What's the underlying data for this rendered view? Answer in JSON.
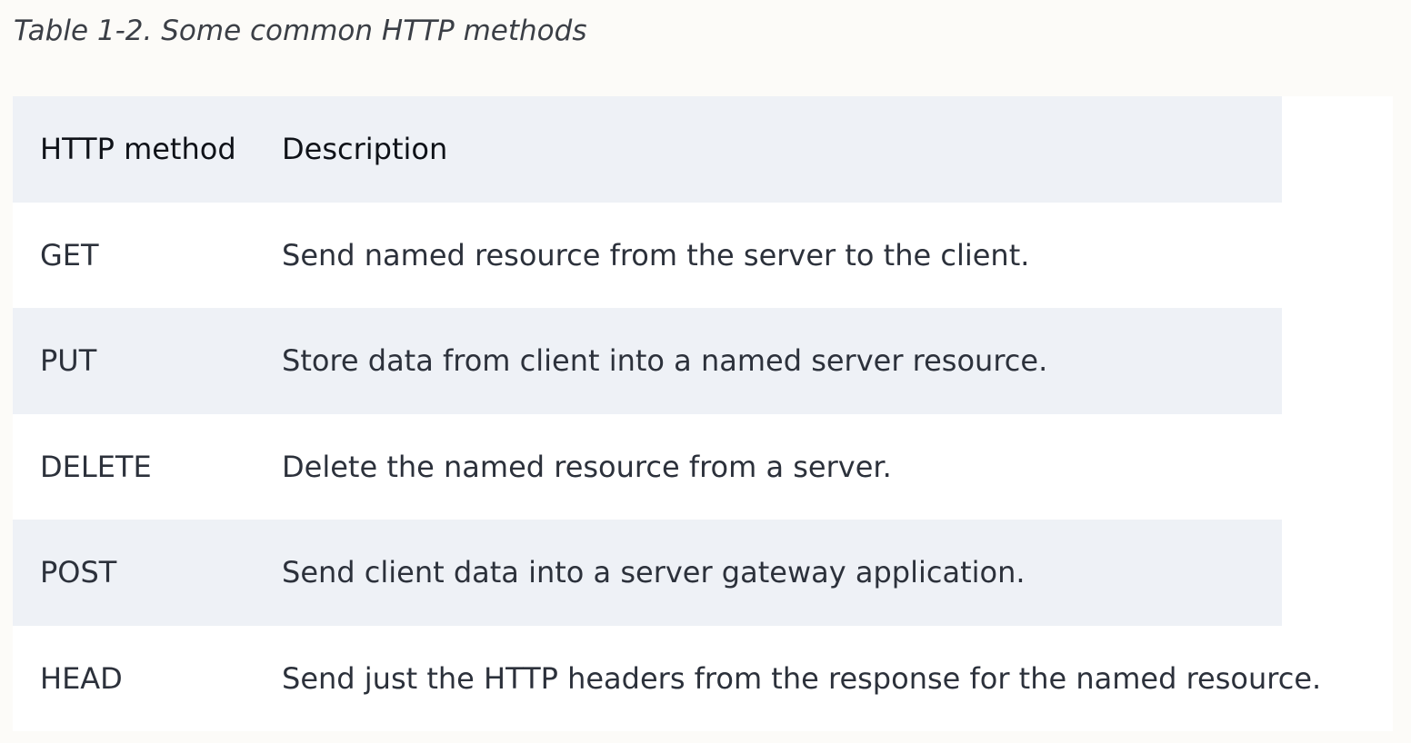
{
  "caption": "Table 1-2. Some common HTTP methods",
  "table": {
    "headers": [
      "HTTP method",
      "Description"
    ],
    "rows": [
      {
        "method": "GET",
        "description": "Send named resource from the server to the client."
      },
      {
        "method": "PUT",
        "description": "Store data from client into a named server resource."
      },
      {
        "method": "DELETE",
        "description": "Delete the named resource from a server."
      },
      {
        "method": "POST",
        "description": "Send client data into a server gateway application."
      },
      {
        "method": "HEAD",
        "description": "Send just the HTTP headers from the response for the named resource."
      }
    ]
  },
  "colors": {
    "page_background": "#fcfbf8",
    "shaded_row": "#eef1f6",
    "plain_row": "#ffffff",
    "text": "#2c313b"
  }
}
